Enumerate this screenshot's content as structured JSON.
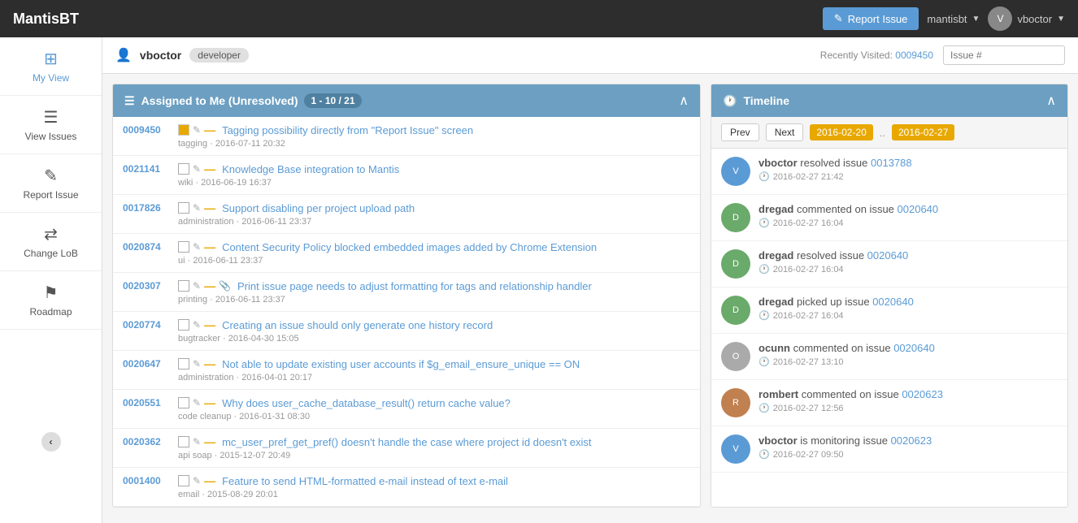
{
  "app": {
    "brand": "MantisBT",
    "title": "MantisBT"
  },
  "navbar": {
    "report_issue_btn": "Report Issue",
    "user_account": "mantisbt",
    "user_name": "vboctor",
    "search_placeholder": "Issue #"
  },
  "sidebar": {
    "items": [
      {
        "id": "my-view",
        "label": "My View",
        "icon": "⊞",
        "active": true
      },
      {
        "id": "view-issues",
        "label": "View Issues",
        "icon": "☰",
        "active": false
      },
      {
        "id": "report-issue",
        "label": "Report Issue",
        "icon": "✎",
        "active": false
      },
      {
        "id": "change-log",
        "label": "Change LoB",
        "icon": "⇄",
        "active": false
      },
      {
        "id": "roadmap",
        "label": "Roadmap",
        "icon": "⚑",
        "active": false
      }
    ]
  },
  "user_bar": {
    "username": "vboctor",
    "role": "developer",
    "recently_visited_label": "Recently Visited:",
    "recently_visited_id": "0009450",
    "search_placeholder": "Issue #"
  },
  "issues_panel": {
    "title": "Assigned to Me (Unresolved)",
    "pagination": "1 - 10 / 21",
    "issues": [
      {
        "id": "0009450",
        "title": "Tagging possibility directly from \"Report Issue\" screen",
        "meta": "tagging · 2016-07-11 20:32",
        "controls": [
          "color",
          "edit",
          "minus"
        ]
      },
      {
        "id": "0021141",
        "title": "Knowledge Base integration to Mantis",
        "meta": "wiki · 2016-06-19 16:37",
        "controls": [
          "box",
          "edit",
          "minus"
        ]
      },
      {
        "id": "0017826",
        "title": "Support disabling per project upload path",
        "meta": "administration · 2016-06-11 23:37",
        "controls": [
          "box",
          "edit",
          "minus"
        ]
      },
      {
        "id": "0020874",
        "title": "Content Security Policy blocked embedded images added by Chrome Extension",
        "meta": "ui · 2016-06-11 23:37",
        "controls": [
          "box",
          "edit",
          "minus"
        ]
      },
      {
        "id": "0020307",
        "title": "Print issue page needs to adjust formatting for tags and relationship handler",
        "meta": "printing · 2016-06-11 23:37",
        "controls": [
          "box",
          "edit",
          "minus",
          "clip"
        ]
      },
      {
        "id": "0020774",
        "title": "Creating an issue should only generate one history record",
        "meta": "bugtracker · 2016-04-30 15:05",
        "controls": [
          "box",
          "edit",
          "minus"
        ]
      },
      {
        "id": "0020647",
        "title": "Not able to update existing user accounts if $g_email_ensure_unique == ON",
        "meta": "administration · 2016-04-01 20:17",
        "controls": [
          "box",
          "edit",
          "minus"
        ]
      },
      {
        "id": "0020551",
        "title": "Why does user_cache_database_result() return cache value?",
        "meta": "code cleanup · 2016-01-31 08:30",
        "controls": [
          "box",
          "edit",
          "minus"
        ]
      },
      {
        "id": "0020362",
        "title": "mc_user_pref_get_pref() doesn't handle the case where project id doesn't exist",
        "meta": "api soap · 2015-12-07 20:49",
        "controls": [
          "box",
          "edit",
          "minus"
        ]
      },
      {
        "id": "0001400",
        "title": "Feature to send HTML-formatted e-mail instead of text e-mail",
        "meta": "email · 2015-08-29 20:01",
        "controls": [
          "box",
          "edit",
          "minus"
        ]
      }
    ]
  },
  "timeline_panel": {
    "title": "Timeline",
    "prev_label": "Prev",
    "next_label": "Next",
    "date_from": "2016-02-20",
    "date_to": "2016-02-27",
    "items": [
      {
        "user": "vboctor",
        "action": "resolved issue",
        "issue_id": "0013788",
        "time": "2016-02-27 21:42",
        "avatar_color": "#5b9bd5",
        "avatar_initials": "V"
      },
      {
        "user": "dregad",
        "action": "commented on issue",
        "issue_id": "0020640",
        "time": "2016-02-27 16:04",
        "avatar_color": "#6aaa6a",
        "avatar_initials": "D"
      },
      {
        "user": "dregad",
        "action": "resolved issue",
        "issue_id": "0020640",
        "time": "2016-02-27 16:04",
        "avatar_color": "#6aaa6a",
        "avatar_initials": "D"
      },
      {
        "user": "dregad",
        "action": "picked up issue",
        "issue_id": "0020640",
        "time": "2016-02-27 16:04",
        "avatar_color": "#6aaa6a",
        "avatar_initials": "D"
      },
      {
        "user": "ocunn",
        "action": "commented on issue",
        "issue_id": "0020640",
        "time": "2016-02-27 13:10",
        "avatar_color": "#aaa",
        "avatar_initials": "O"
      },
      {
        "user": "rombert",
        "action": "commented on issue",
        "issue_id": "0020623",
        "time": "2016-02-27 12:56",
        "avatar_color": "#c08050",
        "avatar_initials": "R"
      },
      {
        "user": "vboctor",
        "action": "is monitoring issue",
        "issue_id": "0020623",
        "time": "2016-02-27 09:50",
        "avatar_color": "#5b9bd5",
        "avatar_initials": "V"
      }
    ]
  }
}
